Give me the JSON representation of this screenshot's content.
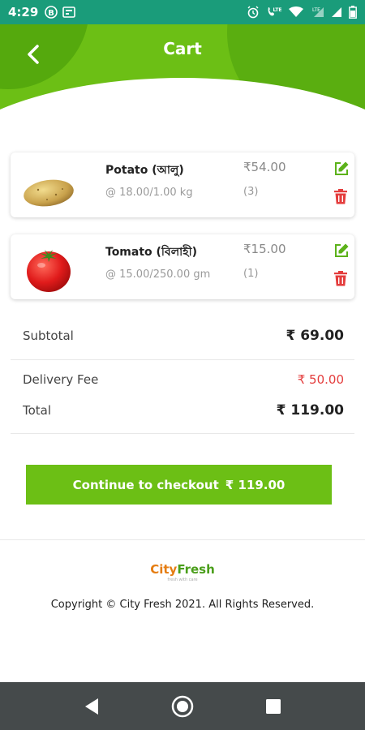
{
  "status_bar": {
    "time": "4:29",
    "icons": [
      "b-circle-icon",
      "news-icon",
      "alarm-icon",
      "volte-call-icon",
      "wifi-icon",
      "lte-signal-icon",
      "signal-icon",
      "battery-icon"
    ],
    "lte_label": "LTE"
  },
  "header": {
    "title": "Cart",
    "back_icon": "chevron-left-icon"
  },
  "colors": {
    "status_bar": "#1a9c7a",
    "accent_green": "#6cbf15",
    "danger_red": "#e43d3d",
    "nav_bar": "#454a4b"
  },
  "cart": {
    "items": [
      {
        "name": "Potato (আলু)",
        "rate": "@ 18.00/1.00 kg",
        "price": "₹54.00",
        "quantity": "(3)",
        "image": "potato-image"
      },
      {
        "name": "Tomato (বিলাহী)",
        "rate": "@ 15.00/250.00 gm",
        "price": "₹15.00",
        "quantity": "(1)",
        "image": "tomato-image"
      }
    ]
  },
  "summary": {
    "subtotal_label": "Subtotal",
    "subtotal_value": "₹ 69.00",
    "delivery_label": "Delivery Fee",
    "delivery_value": "₹ 50.00",
    "total_label": "Total",
    "total_value": "₹ 119.00"
  },
  "checkout": {
    "label": "Continue to checkout",
    "amount": "₹ 119.00"
  },
  "footer": {
    "brand_part1": "City",
    "brand_part2": "Fresh",
    "tagline": "fresh with care",
    "copyright": "Copyright © City Fresh 2021. All Rights Reserved."
  },
  "nav_bar": {
    "buttons": [
      "back-triangle-icon",
      "home-circle-icon",
      "recents-square-icon"
    ]
  }
}
